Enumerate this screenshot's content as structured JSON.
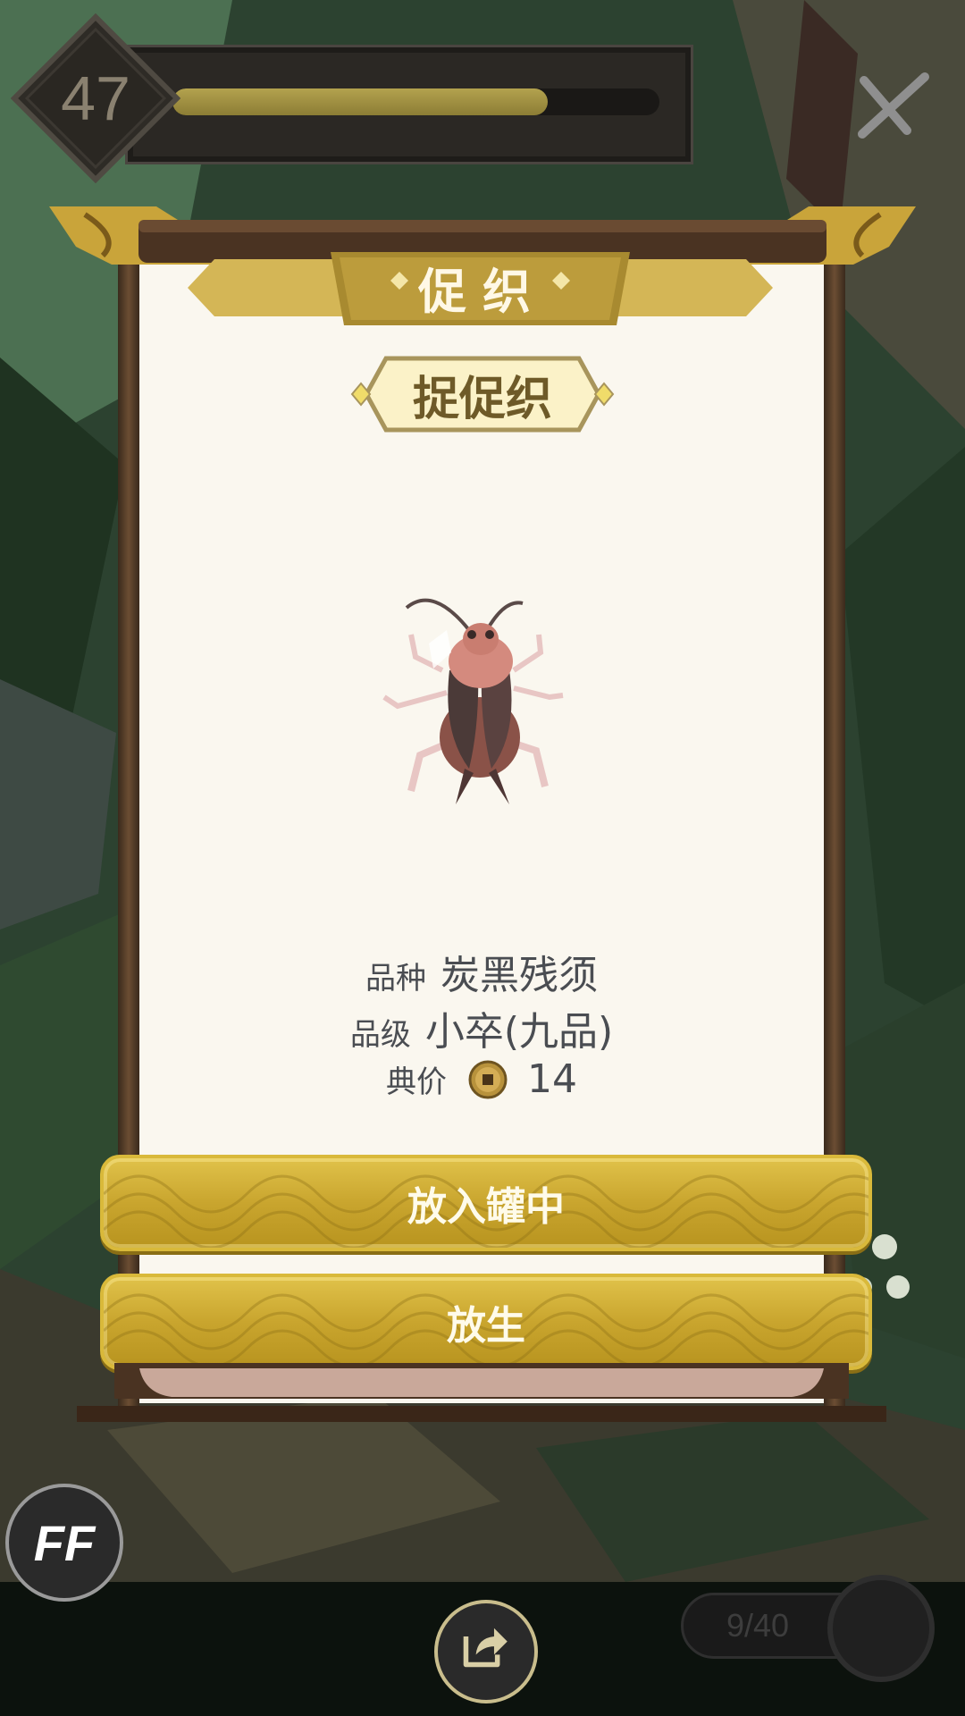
{
  "player": {
    "level": "47",
    "xp_progress": 0.77
  },
  "dialog": {
    "title": "促织",
    "subtitle": "捉促织",
    "creature_icon": "cricket-icon",
    "info": {
      "species_label": "品种",
      "species_value": "炭黑残须",
      "grade_label": "品级",
      "grade_value": "小卒(九品)",
      "price_label": "典价",
      "price_icon": "coin-icon",
      "price_value": "14"
    },
    "buttons": {
      "store_label": "放入罐中",
      "release_label": "放生"
    }
  },
  "bottom_bar": {
    "ff_label": "FF",
    "share_icon": "share-icon",
    "counter": "9/40"
  },
  "colors": {
    "gold": "#c9a52e",
    "paper": "#faf7ef",
    "wood": "#4a3322",
    "text": "#4a4d52"
  }
}
